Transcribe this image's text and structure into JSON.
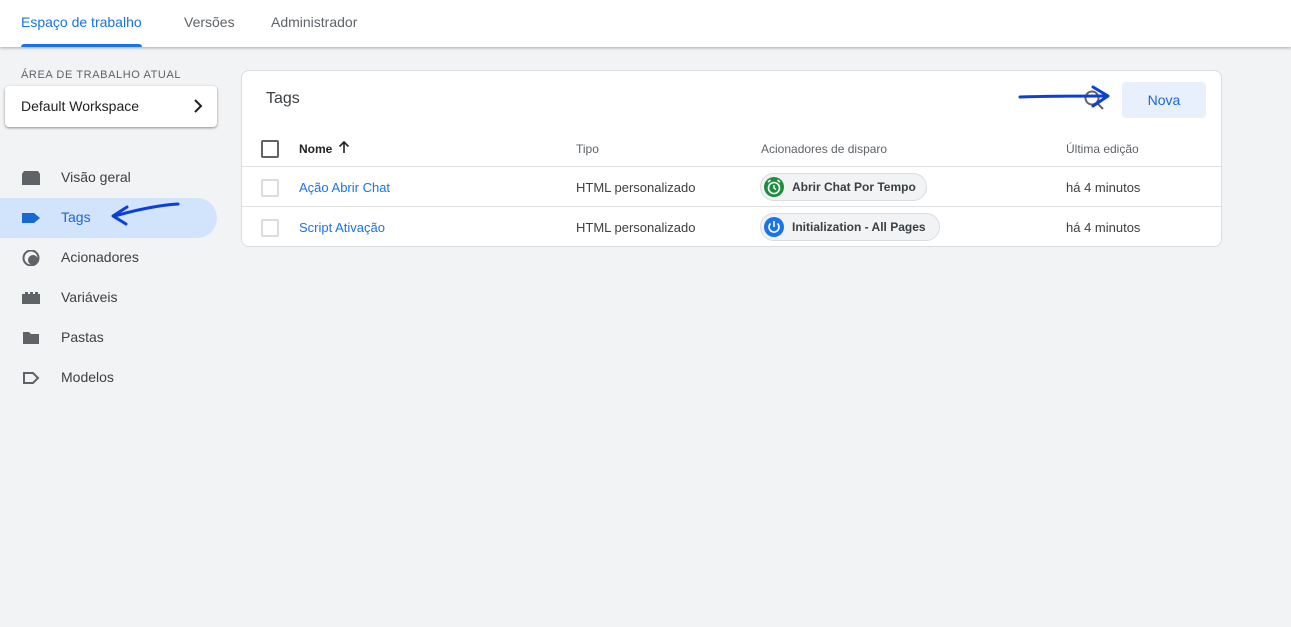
{
  "topbar": {
    "tabs": [
      {
        "label": "Espaço de trabalho",
        "active": true
      },
      {
        "label": "Versões",
        "active": false
      },
      {
        "label": "Administrador",
        "active": false
      }
    ]
  },
  "sidebar": {
    "workspace_label": "ÁREA DE TRABALHO ATUAL",
    "workspace_name": "Default Workspace",
    "items": [
      {
        "label": "Visão geral",
        "icon": "overview-icon"
      },
      {
        "label": "Tags",
        "icon": "tag-icon",
        "active": true
      },
      {
        "label": "Acionadores",
        "icon": "trigger-icon"
      },
      {
        "label": "Variáveis",
        "icon": "variables-icon"
      },
      {
        "label": "Pastas",
        "icon": "folder-icon"
      },
      {
        "label": "Modelos",
        "icon": "template-icon"
      }
    ]
  },
  "main": {
    "title": "Tags",
    "new_button": "Nova",
    "columns": {
      "name": "Nome",
      "type": "Tipo",
      "triggers": "Acionadores de disparo",
      "last_edit": "Última edição"
    },
    "rows": [
      {
        "name": "Ação Abrir Chat",
        "type": "HTML personalizado",
        "trigger": "Abrir Chat Por Tempo",
        "trigger_icon": "alarm-icon",
        "last_edit": "há 4 minutos"
      },
      {
        "name": "Script Ativação",
        "type": "HTML personalizado",
        "trigger": "Initialization - All Pages",
        "trigger_icon": "power-icon",
        "last_edit": "há 4 minutos"
      }
    ]
  },
  "colors": {
    "accent": "#1a73e8",
    "active_nav_bg": "#d2e3fc",
    "annotation_arrow": "#0b3fd6",
    "trigger_green": "#1e8e3e"
  }
}
